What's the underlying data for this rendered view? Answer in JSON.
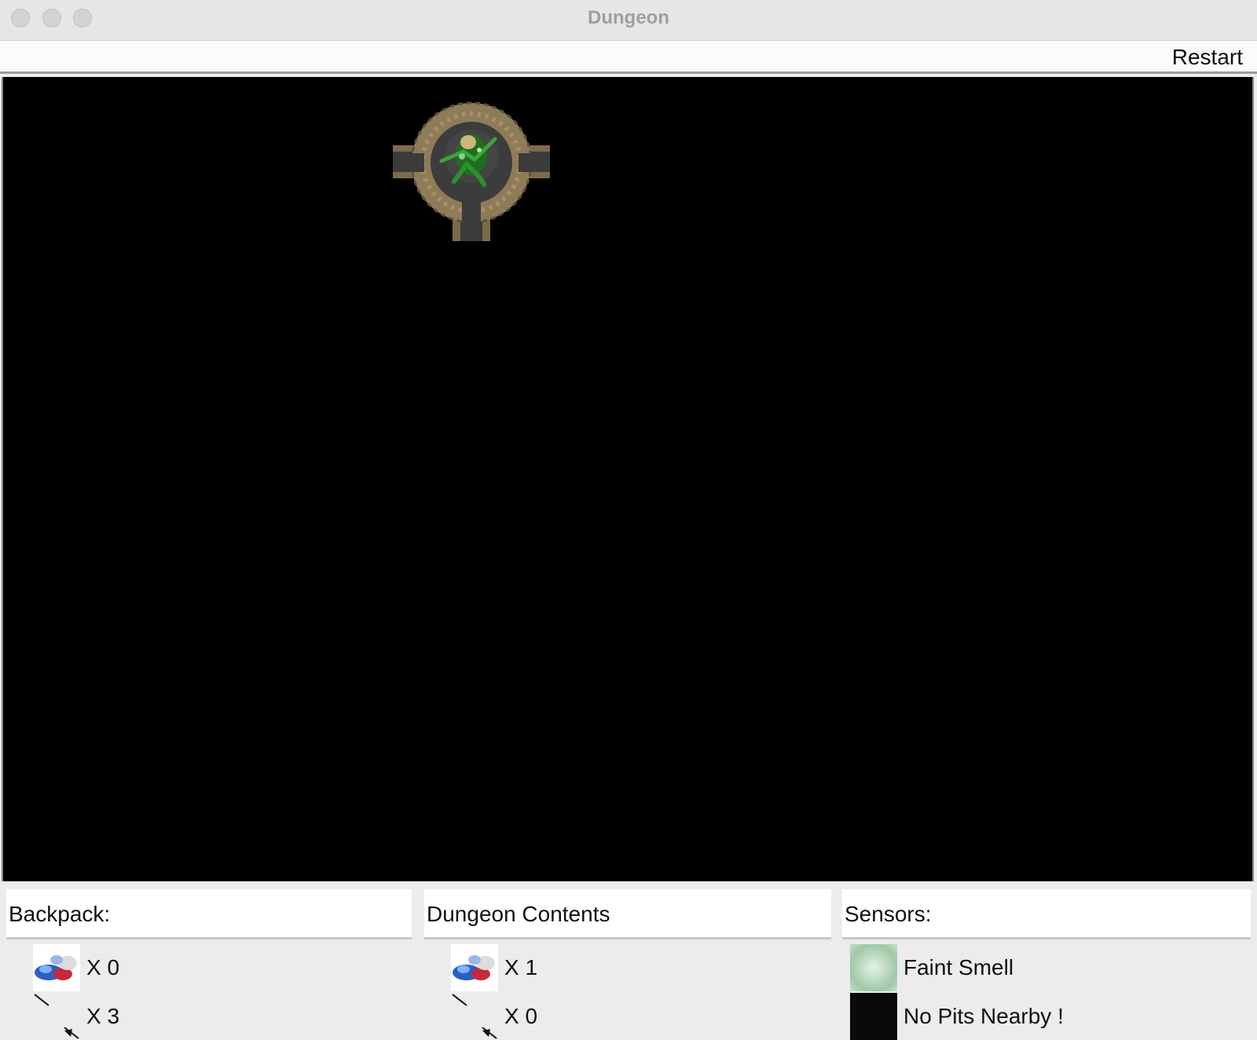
{
  "window": {
    "title": "Dungeon"
  },
  "menu": {
    "restart_label": "Restart"
  },
  "backpack": {
    "header": "Backpack:",
    "treasure": {
      "icon": "treasure-gems-icon",
      "count_text": "X  0"
    },
    "arrows": {
      "icon": "arrows-icon",
      "count_text": "X 3"
    }
  },
  "dungeon_contents": {
    "header": "Dungeon Contents",
    "treasure": {
      "icon": "treasure-gems-icon",
      "count_text": "X 1"
    },
    "arrows": {
      "icon": "arrows-icon",
      "count_text": "X 0"
    }
  },
  "sensors": {
    "header": "Sensors:",
    "smell": {
      "icon": "smell-icon",
      "text": "Faint Smell"
    },
    "pits": {
      "icon": "pit-icon",
      "text": "No Pits Nearby !"
    }
  },
  "colors": {
    "canvas": "#000000",
    "wall_stone": "#8a7a5c",
    "floor": "#3a3a3a",
    "player_green": "#2e8b2e"
  }
}
